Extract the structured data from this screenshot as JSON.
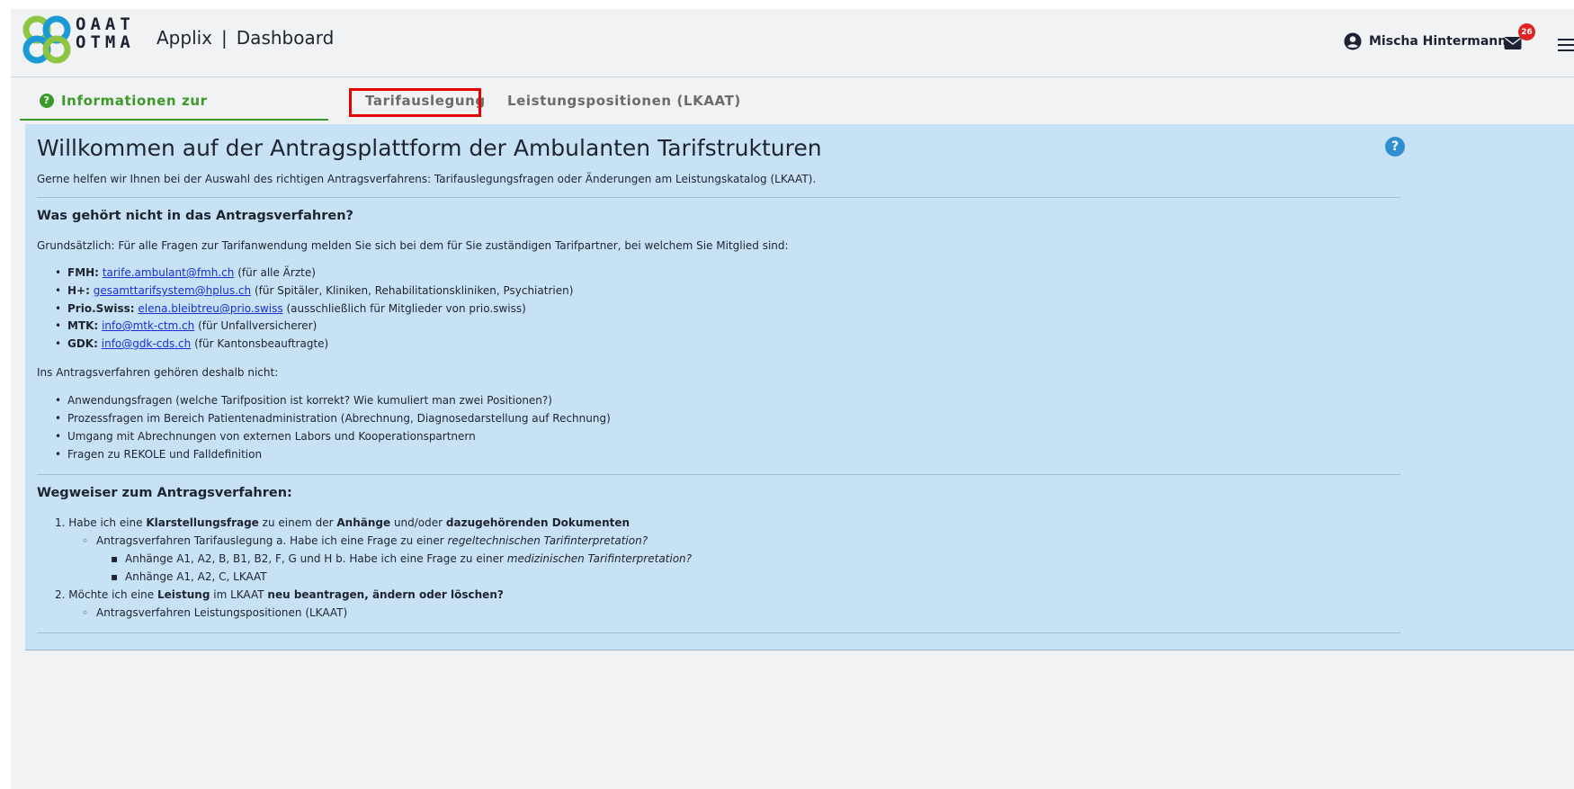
{
  "header": {
    "logo_line1": "OAAT",
    "logo_line2": "OTMA",
    "app_name": "Applix",
    "separator": "|",
    "page": "Dashboard",
    "user_name": "Mischa Hintermann",
    "mail_count": "26"
  },
  "tabs": [
    {
      "label": "Informationen zur Antragsplattform",
      "active": true
    },
    {
      "label": "Tarifauslegung",
      "active": false
    },
    {
      "label": "Leistungspositionen (LKAAT)",
      "active": false
    }
  ],
  "content": {
    "title": "Willkommen auf der Antragsplattform der Ambulanten Tarifstrukturen",
    "intro": "Gerne helfen wir Ihnen bei der Auswahl des richtigen Antragsverfahrens: Tarifauslegungsfragen oder Änderungen am Leistungskatalog (LKAAT).",
    "section1_heading": "Was gehört nicht in das Antragsverfahren?",
    "section1_text": "Grundsätzlich: Für alle Fragen zur Tarifanwendung melden Sie sich bei dem für Sie zuständigen Tarifpartner, bei welchem Sie Mitglied sind:",
    "contacts": [
      {
        "name": "FMH:",
        "email": "tarife.ambulant@fmh.ch",
        "note": "(für alle Ärzte)"
      },
      {
        "name": "H+:",
        "email": "gesamttarifsystem@hplus.ch",
        "note": "(für Spitäler, Kliniken, Rehabilitationskliniken, Psychiatrien)"
      },
      {
        "name": "Prio.Swiss:",
        "email": "elena.bleibtreu@prio.swiss",
        "note": "(ausschließlich für Mitglieder von prio.swiss)"
      },
      {
        "name": "MTK:",
        "email": "info@mtk-ctm.ch",
        "note": "(für Unfallversicherer)"
      },
      {
        "name": "GDK:",
        "email": "info@gdk-cds.ch",
        "note": "(für Kantonsbeauftragte)"
      }
    ],
    "not_included_intro": "Ins Antragsverfahren gehören deshalb nicht:",
    "not_included": [
      "Anwendungsfragen (welche Tarifposition ist korrekt? Wie kumuliert man zwei Positionen?)",
      "Prozessfragen im Bereich Patientenadministration (Abrechnung, Diagnosedarstellung auf Rechnung)",
      "Umgang mit Abrechnungen von externen Labors und Kooperationspartnern",
      "Fragen zu REKOLE und Falldefinition"
    ],
    "section2_heading": "Wegweiser zum Antragsverfahren:",
    "guide": {
      "item1_num": "1.",
      "item1_a": "Habe ich eine",
      "item1_b": "Klarstellungsfrage",
      "item1_c": "zu einem der",
      "item1_d": "Anhänge",
      "item1_e": "und/oder",
      "item1_f": "dazugehörenden Dokumenten",
      "item1_sub_a": "Antragsverfahren Tarifauslegung a. Habe ich eine Frage zu einer",
      "item1_sub_b": "regeltechnischen Tarifinterpretation?",
      "item1_sub1_a": "Anhänge A1, A2, B, B1, B2, F, G und H b. Habe ich eine Frage zu einer",
      "item1_sub1_b": "medizinischen Tarifinterpretation?",
      "item1_sub2": "Anhänge A1, A2, C, LKAAT",
      "item2_num": "2.",
      "item2_a": "Möchte ich eine",
      "item2_b": "Leistung",
      "item2_c": "im LKAAT",
      "item2_d": "neu beantragen, ändern oder löschen?",
      "item2_sub": "Antragsverfahren Leistungspositionen (LKAAT)"
    }
  },
  "colors": {
    "accent_green": "#3d9a2a",
    "panel_blue": "#c6e2f4",
    "link_blue": "#1a2fd1",
    "highlight_red": "#e60000",
    "badge_red": "#e02424"
  },
  "icons": [
    "logo-icon",
    "user-icon",
    "mail-icon",
    "menu-icon",
    "help-icon",
    "question-icon"
  ]
}
